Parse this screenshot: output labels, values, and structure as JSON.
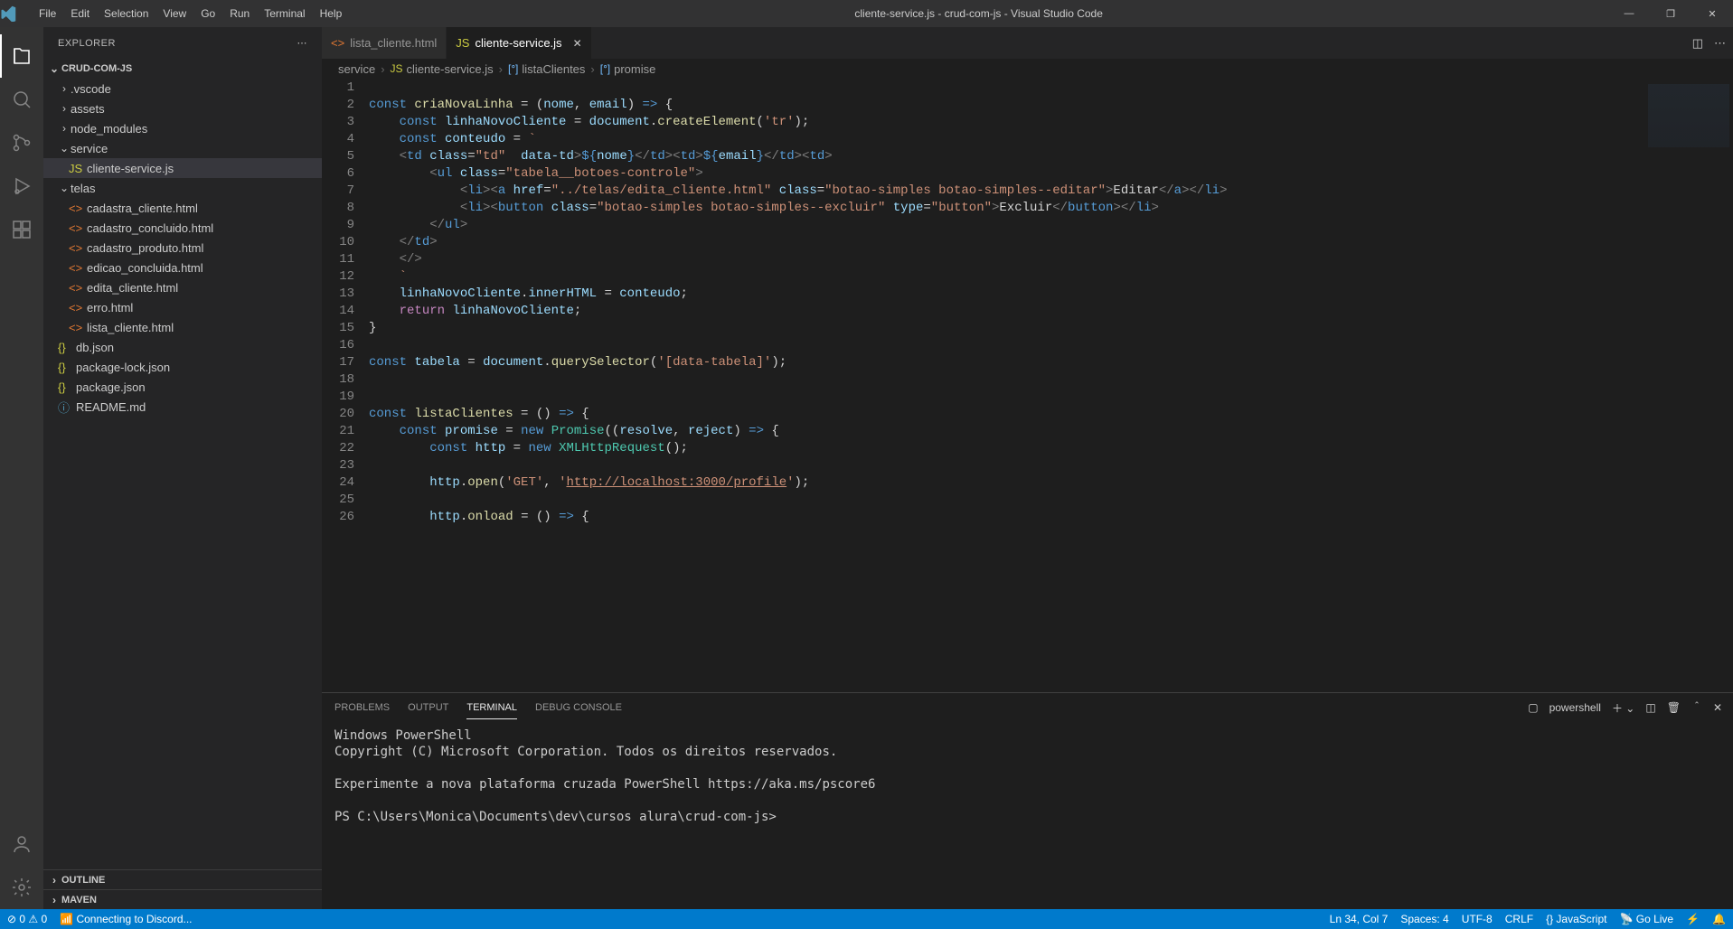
{
  "title": "cliente-service.js - crud-com-js - Visual Studio Code",
  "menu": [
    "File",
    "Edit",
    "Selection",
    "View",
    "Go",
    "Run",
    "Terminal",
    "Help"
  ],
  "window_controls": {
    "min": "—",
    "max": "❐",
    "close": "✕"
  },
  "activity": {
    "items": [
      "explorer",
      "search",
      "source-control",
      "run-debug",
      "extensions"
    ],
    "bottom": [
      "accounts",
      "settings"
    ]
  },
  "explorer": {
    "title": "EXPLORER",
    "root": "CRUD-COM-JS",
    "tree": [
      {
        "type": "folder",
        "name": ".vscode",
        "depth": 1,
        "open": false
      },
      {
        "type": "folder",
        "name": "assets",
        "depth": 1,
        "open": false
      },
      {
        "type": "folder",
        "name": "node_modules",
        "depth": 1,
        "open": false
      },
      {
        "type": "folder",
        "name": "service",
        "depth": 1,
        "open": true
      },
      {
        "type": "file",
        "name": "cliente-service.js",
        "depth": 2,
        "icon": "JS",
        "iconClass": "fc-yellow",
        "selected": true
      },
      {
        "type": "folder",
        "name": "telas",
        "depth": 1,
        "open": true
      },
      {
        "type": "file",
        "name": "cadastra_cliente.html",
        "depth": 2,
        "icon": "<>",
        "iconClass": "fc-orange"
      },
      {
        "type": "file",
        "name": "cadastro_concluido.html",
        "depth": 2,
        "icon": "<>",
        "iconClass": "fc-orange"
      },
      {
        "type": "file",
        "name": "cadastro_produto.html",
        "depth": 2,
        "icon": "<>",
        "iconClass": "fc-orange"
      },
      {
        "type": "file",
        "name": "edicao_concluida.html",
        "depth": 2,
        "icon": "<>",
        "iconClass": "fc-orange"
      },
      {
        "type": "file",
        "name": "edita_cliente.html",
        "depth": 2,
        "icon": "<>",
        "iconClass": "fc-orange"
      },
      {
        "type": "file",
        "name": "erro.html",
        "depth": 2,
        "icon": "<>",
        "iconClass": "fc-orange"
      },
      {
        "type": "file",
        "name": "lista_cliente.html",
        "depth": 2,
        "icon": "<>",
        "iconClass": "fc-orange"
      },
      {
        "type": "file",
        "name": "db.json",
        "depth": 1,
        "icon": "{}",
        "iconClass": "fc-yellow"
      },
      {
        "type": "file",
        "name": "package-lock.json",
        "depth": 1,
        "icon": "{}",
        "iconClass": "fc-yellow"
      },
      {
        "type": "file",
        "name": "package.json",
        "depth": 1,
        "icon": "{}",
        "iconClass": "fc-yellow"
      },
      {
        "type": "file",
        "name": "README.md",
        "depth": 1,
        "icon": "ⓘ",
        "iconClass": "fc-blue"
      }
    ],
    "footer_sections": [
      "OUTLINE",
      "MAVEN"
    ]
  },
  "tabs": [
    {
      "label": "lista_cliente.html",
      "icon": "<>",
      "iconClass": "fc-orange",
      "active": false
    },
    {
      "label": "cliente-service.js",
      "icon": "JS",
      "iconClass": "fc-yellow",
      "active": true,
      "closable": true
    }
  ],
  "breadcrumbs": [
    {
      "label": "service"
    },
    {
      "label": "cliente-service.js",
      "icon": "JS",
      "iconClass": "bc-icon-y"
    },
    {
      "label": "listaClientes",
      "icon": "[ᐤ]",
      "iconClass": "bc-icon-b"
    },
    {
      "label": "promise",
      "icon": "[ᐤ]",
      "iconClass": "bc-icon-b"
    }
  ],
  "code_lines": [
    "1",
    "2",
    "3",
    "4",
    "5",
    "6",
    "7",
    "8",
    "9",
    "10",
    "11",
    "12",
    "13",
    "14",
    "15",
    "16",
    "17",
    "18",
    "19",
    "20",
    "21",
    "22",
    "23",
    "24",
    "25",
    "26"
  ],
  "panel": {
    "tabs": [
      "PROBLEMS",
      "OUTPUT",
      "TERMINAL",
      "DEBUG CONSOLE"
    ],
    "active": "TERMINAL",
    "shell": "powershell",
    "text": "Windows PowerShell\nCopyright (C) Microsoft Corporation. Todos os direitos reservados.\n\nExperimente a nova plataforma cruzada PowerShell https://aka.ms/pscore6\n\nPS C:\\Users\\Monica\\Documents\\dev\\cursos alura\\crud-com-js>"
  },
  "status": {
    "left": [
      "⊘ 0 ⚠ 0",
      "📶 Connecting to Discord..."
    ],
    "right": [
      "Ln 34, Col 7",
      "Spaces: 4",
      "UTF-8",
      "CRLF",
      "{} JavaScript",
      "📡 Go Live",
      "⚡",
      "🔔"
    ]
  }
}
